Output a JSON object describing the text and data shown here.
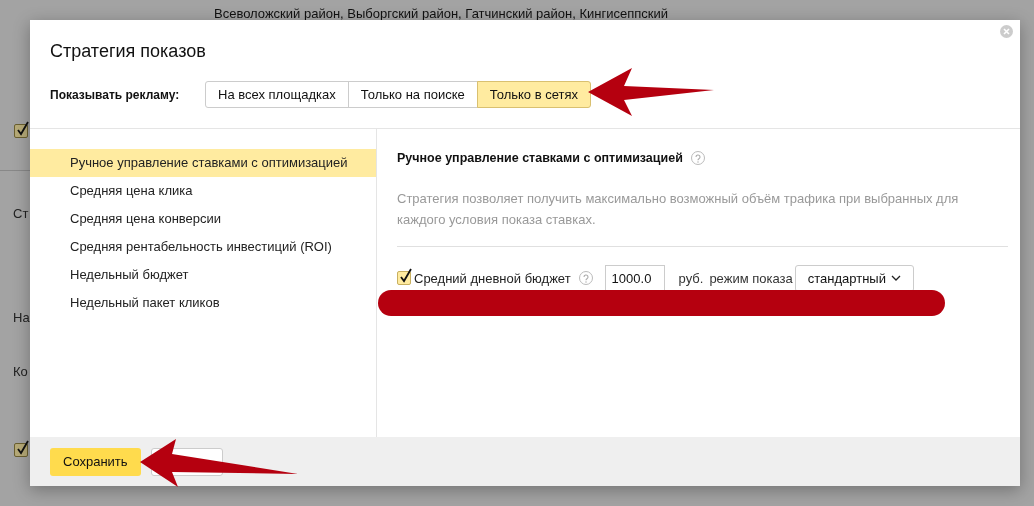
{
  "background": {
    "region_text": "Всеволожский район, Выборгский район, Гатчинский район, Кингисеппский",
    "fragments": [
      "Ст",
      "На",
      "Ко"
    ],
    "checkboxes": [
      {
        "checked": true
      },
      {
        "checked": true
      }
    ]
  },
  "dialog": {
    "title": "Стратегия показов",
    "show_ads": {
      "label": "Показывать рекламу:",
      "tabs": [
        {
          "label": "На всех площадках",
          "selected": false
        },
        {
          "label": "Только на поиске",
          "selected": false
        },
        {
          "label": "Только в сетях",
          "selected": true
        }
      ]
    },
    "strategies": [
      {
        "label": "Ручное управление ставками с оптимизацией",
        "selected": true
      },
      {
        "label": "Средняя цена клика",
        "selected": false
      },
      {
        "label": "Средняя цена конверсии",
        "selected": false
      },
      {
        "label": "Средняя рентабельность инвестиций (ROI)",
        "selected": false
      },
      {
        "label": "Недельный бюджет",
        "selected": false
      },
      {
        "label": "Недельный пакет кликов",
        "selected": false
      }
    ],
    "detail": {
      "title": "Ручное управление ставками с оптимизацией",
      "description": "Стратегия позволяет получить максимально возможный объём трафика при выбранных для каждого условия показа ставках.",
      "budget": {
        "checked": true,
        "label": "Средний дневной бюджет",
        "value": "1000.0",
        "currency": "руб.",
        "mode_label": "режим показа",
        "mode": "стандартный"
      }
    },
    "save_button": "Сохранить"
  }
}
